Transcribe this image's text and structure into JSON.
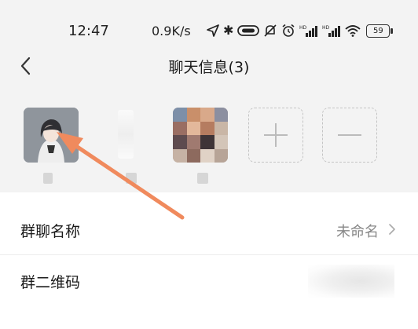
{
  "status_bar": {
    "time": "12:47",
    "network_speed": "0.9K/s",
    "battery_level": "59",
    "icons": [
      "location-icon",
      "bluetooth-icon",
      "hd-icon",
      "mute-icon",
      "alarm-icon",
      "signal-icon",
      "signal-icon",
      "wifi-icon",
      "battery-icon"
    ]
  },
  "header": {
    "title": "聊天信息(3)",
    "back_icon": "chevron-left-icon"
  },
  "members": {
    "add_icon": "plus-icon",
    "remove_icon": "minus-icon"
  },
  "settings": {
    "group_name": {
      "label": "群聊名称",
      "value": "未命名"
    },
    "group_qr": {
      "label": "群二维码"
    }
  },
  "annotation": {
    "color": "#f08a5d",
    "icon": "arrow-annotation"
  }
}
